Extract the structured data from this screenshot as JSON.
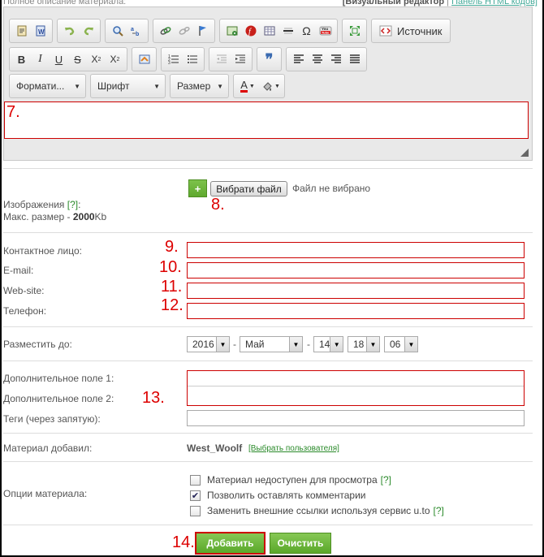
{
  "top": {
    "left_text": "Полное описание материала:",
    "visual_editor": "[Визуальный редактор",
    "html_panel": "Панель HTML кодов]"
  },
  "toolbar": {
    "source_label": "Источник",
    "format_label": "Формати...",
    "font_label": "Шрифт",
    "size_label": "Размер"
  },
  "annotations": {
    "n7": "7.",
    "n8": "8.",
    "n9": "9.",
    "n10": "10.",
    "n11": "11.",
    "n12": "12.",
    "n13": "13.",
    "n14": "14."
  },
  "images": {
    "label": "Изображения",
    "help": "[?]",
    "colon": ":",
    "max_size_prefix": "Макс. размер - ",
    "max_size_value": "2000",
    "max_size_unit": "Kb",
    "plus": "+",
    "choose_file": "Вибрати файл",
    "no_file": "Файл не вибрано"
  },
  "contacts": {
    "person_label": "Контактное лицо:",
    "email_label": "E-mail:",
    "website_label": "Web-site:",
    "phone_label": "Телефон:"
  },
  "publish": {
    "label": "Разместить до:",
    "year": "2016",
    "month": "Май",
    "day": "14",
    "hour": "18",
    "minute": "06",
    "dash": "-"
  },
  "extra": {
    "field1_label": "Дополнительное поле 1:",
    "field2_label": "Дополнительное поле 2:",
    "tags_label": "Теги (через запятую):"
  },
  "author": {
    "label": "Материал добавил:",
    "user": "West_Woolf",
    "choose_user": "[Выбрать пользователя]"
  },
  "options": {
    "label": "Опции материала:",
    "items": [
      {
        "label": "Материал недоступен для просмотра",
        "checked": false,
        "help": "[?]"
      },
      {
        "label": "Позволить оставлять комментарии",
        "checked": true,
        "help": ""
      },
      {
        "label": "Заменить внешние ссылки используя сервис u.to",
        "checked": false,
        "help": "[?]"
      }
    ]
  },
  "actions": {
    "add": "Добавить",
    "clear": "Очистить"
  }
}
